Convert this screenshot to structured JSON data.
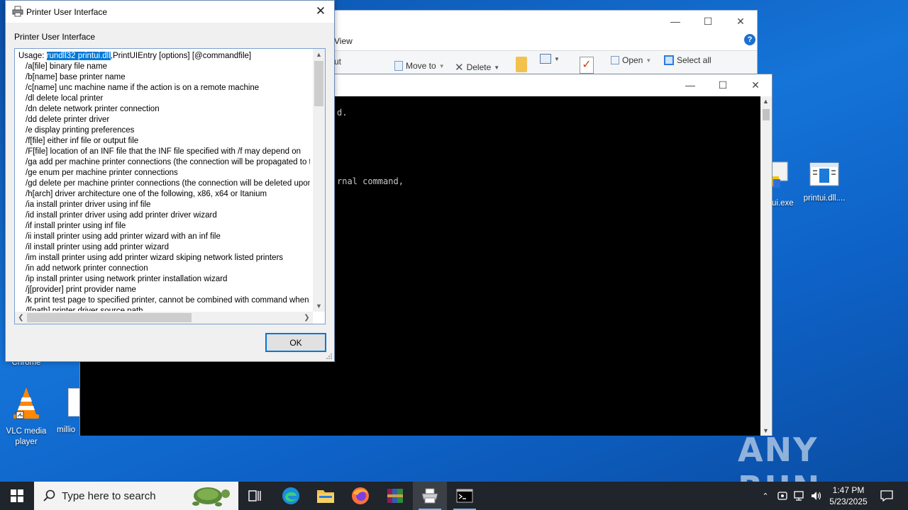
{
  "dialog": {
    "title": "Printer User Interface",
    "group_label": "Printer User Interface",
    "selected_text": "rundll32 printui.dll",
    "first_line_prefix": "Usage: ",
    "first_line_suffix": ",PrintUIEntry [options] [@commandfile]",
    "lines": [
      "/a[file] binary file name",
      "/b[name] base printer name",
      "/c[name] unc machine name if the action is on a remote machine",
      "/dl delete local printer",
      "/dn delete network printer connection",
      "/dd delete printer driver",
      "/e display printing preferences",
      "/f[file] either inf file or output file",
      "/F[file] location of an INF file that the INF file specified with /f may depend on",
      "/ga add per machine printer connections (the connection will be propagated to the user",
      "/ge enum per machine printer connections",
      "/gd delete per machine printer connections (the connection will be deleted upon user",
      "/h[arch] driver architecture one of the following, x86, x64 or Itanium",
      "/ia install printer driver using inf file",
      "/id install printer driver using add printer driver wizard",
      "/if install printer using inf file",
      "/ii install printer using add printer wizard with an inf file",
      "/il install printer using add printer wizard",
      "/im install printer using add printer wizard skiping network listed printers",
      "/in add network printer connection",
      "/ip install printer using network printer installation wizard",
      "/j[provider] print provider name",
      "/k print test page to specified printer, cannot be combined with command when installing",
      "/l[path] printer driver source path"
    ],
    "ok_label": "OK"
  },
  "explorer": {
    "tab_view": "View",
    "ribbon": {
      "cut": "ut",
      "move_to": "Move to",
      "delete": "Delete",
      "open": "Open",
      "select_all": "Select all"
    }
  },
  "console": {
    "line1": "d.",
    "line2": "rnal command,"
  },
  "desktop_icons": {
    "chrome": "Chrome",
    "vlc": "VLC media player",
    "million": "millio",
    "exe": "ui.exe",
    "printui": "printui.dll...."
  },
  "watermark": "ANY RUN",
  "taskbar": {
    "search_placeholder": "Type here to search",
    "time": "1:47 PM",
    "date": "5/23/2025"
  }
}
